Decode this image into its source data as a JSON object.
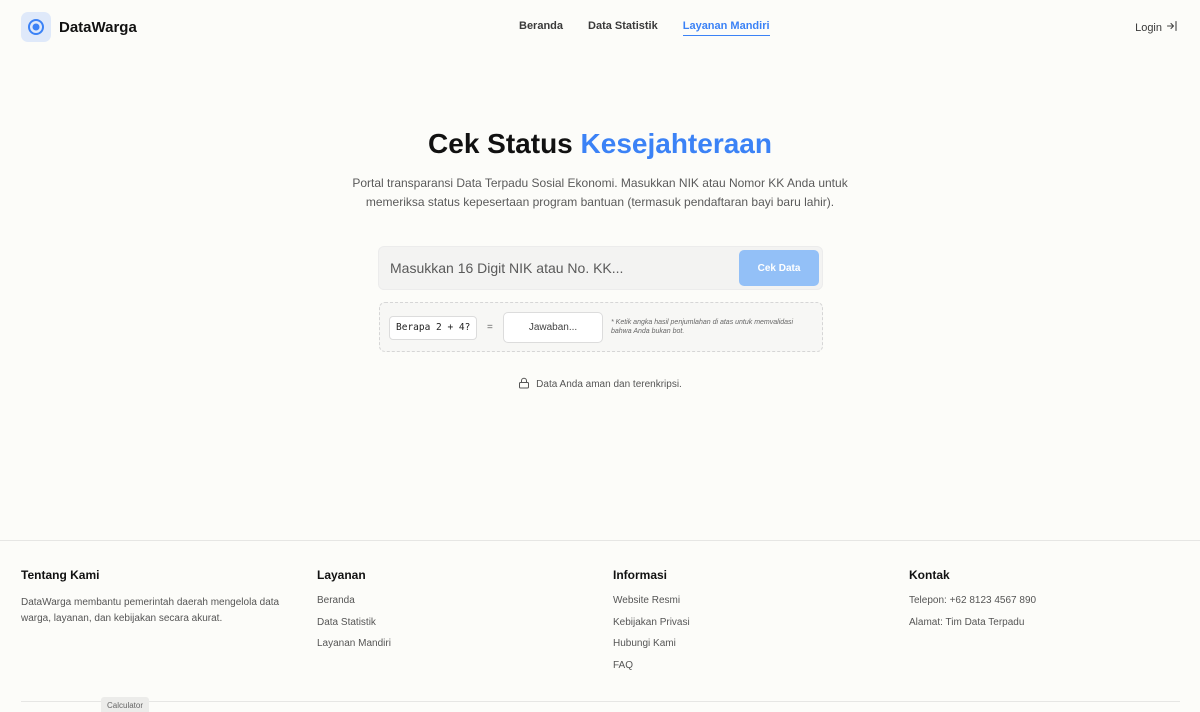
{
  "brand": {
    "name": "DataWarga"
  },
  "nav": {
    "items": [
      {
        "label": "Beranda",
        "active": false
      },
      {
        "label": "Data Statistik",
        "active": false
      },
      {
        "label": "Layanan Mandiri",
        "active": true
      }
    ],
    "login_label": "Login"
  },
  "hero": {
    "title_main": "Cek Status",
    "title_accent": "Kesejahteraan",
    "subtitle": "Portal transparansi Data Terpadu Sosial Ekonomi. Masukkan NIK atau Nomor KK Anda untuk memeriksa status kepesertaan program bantuan (termasuk pendaftaran bayi baru lahir)."
  },
  "search": {
    "placeholder": "Masukkan 16 Digit NIK atau No. KK...",
    "value": "",
    "button_label": "Cek Data"
  },
  "captcha": {
    "question": "Berapa 2 + 4?",
    "equals": "=",
    "placeholder": "Jawaban...",
    "value": "",
    "note": "* Ketik angka hasil penjumlahan di atas untuk memvalidasi bahwa Anda bukan bot."
  },
  "secure_note": "Data Anda aman dan terenkripsi.",
  "footer": {
    "about": {
      "heading": "Tentang Kami",
      "text": "DataWarga membantu pemerintah daerah mengelola data warga, layanan, dan kebijakan secara akurat."
    },
    "services": {
      "heading": "Layanan",
      "links": [
        "Beranda",
        "Data Statistik",
        "Layanan Mandiri"
      ]
    },
    "info": {
      "heading": "Informasi",
      "links": [
        "Website Resmi",
        "Kebijakan Privasi",
        "Hubungi Kami",
        "FAQ"
      ]
    },
    "contact": {
      "heading": "Kontak",
      "phone": "Telepon: +62 8123 4567 890",
      "address": "Alamat: Tim Data Terpadu"
    }
  },
  "taskbar": {
    "calculator_label": "Calculator"
  },
  "colors": {
    "accent": "#3b82f6",
    "button_disabled": "#93c0f7",
    "background": "#fcfcf9"
  }
}
